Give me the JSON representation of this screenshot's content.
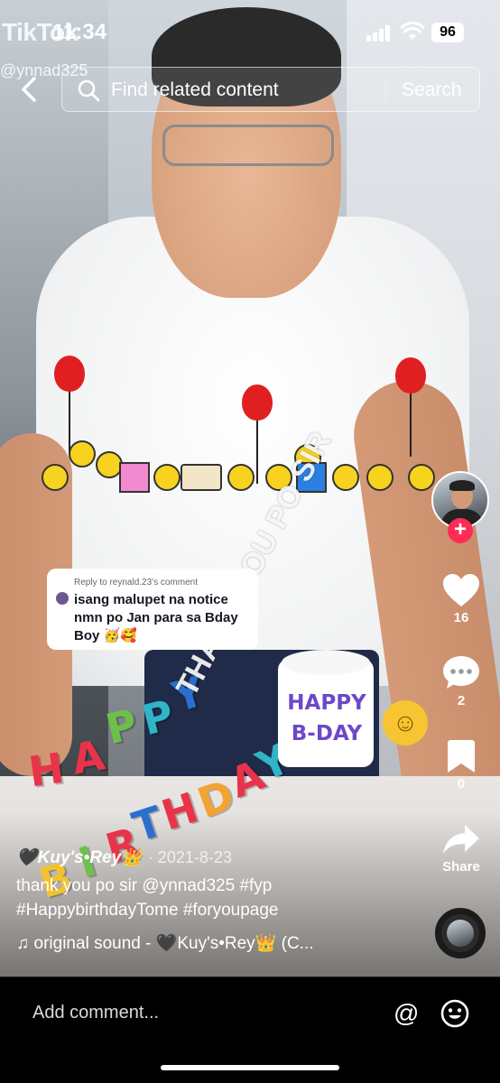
{
  "status_bar": {
    "time": "11:34",
    "battery": "96"
  },
  "watermark": {
    "logo": "TikTok",
    "handle": "@ynnad325"
  },
  "search": {
    "placeholder": "Find related content",
    "button": "Search"
  },
  "reply_bubble": {
    "header": "Reply to reynald.23's comment",
    "text": "isang malupet na notice nmn po Jan para sa Bday Boy 🥳🥰"
  },
  "stickers": {
    "happy_birthday_letters": [
      "H",
      "A",
      "P",
      "P",
      "Y",
      "B",
      "I",
      "R",
      "T",
      "H",
      "D",
      "A",
      "Y"
    ],
    "cake_text_line1": "HAPPY",
    "cake_text_line2": "B-DAY",
    "thanks_text": "THANK YOU PO SIR",
    "emoji": "☺"
  },
  "actions": {
    "likes": "16",
    "comments": "2",
    "saves": "0",
    "share_label": "Share"
  },
  "caption": {
    "author": "🖤Kuy's•Rey👑",
    "date": "· 2021-8-23",
    "text": "thank you po sir @ynnad325 #fyp #HappybirthdayTome #foryoupage",
    "sound": "♫ original sound - 🖤Kuy's•Rey👑  (C..."
  },
  "comment_bar": {
    "placeholder": "Add comment...",
    "mention": "@"
  },
  "colors": {
    "accent": "#fe2c55",
    "bubble_bg": "#ffffff",
    "cake_text": "#6c48c9"
  }
}
